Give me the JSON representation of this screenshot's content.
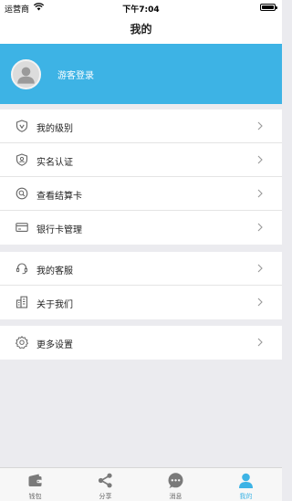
{
  "status_bar": {
    "carrier": "运营商",
    "time": "下午7:04"
  },
  "nav": {
    "title": "我的"
  },
  "profile": {
    "login_label": "游客登录"
  },
  "menu_groups": [
    [
      {
        "label": "我的级别",
        "icon": "shield-icon"
      },
      {
        "label": "实名认证",
        "icon": "id-badge-icon"
      },
      {
        "label": "查看结算卡",
        "icon": "search-icon"
      },
      {
        "label": "银行卡管理",
        "icon": "credit-card-icon"
      }
    ],
    [
      {
        "label": "我的客服",
        "icon": "headset-icon"
      },
      {
        "label": "关于我们",
        "icon": "building-icon"
      }
    ],
    [
      {
        "label": "更多设置",
        "icon": "gear-icon"
      }
    ]
  ],
  "tabs": [
    {
      "label": "钱包",
      "icon": "wallet-icon",
      "active": false
    },
    {
      "label": "分享",
      "icon": "share-icon",
      "active": false
    },
    {
      "label": "消息",
      "icon": "message-icon",
      "active": false
    },
    {
      "label": "我的",
      "icon": "person-icon",
      "active": true
    }
  ],
  "colors": {
    "accent": "#3db3e5",
    "background": "#ebebef",
    "icon_gray": "#666666"
  }
}
